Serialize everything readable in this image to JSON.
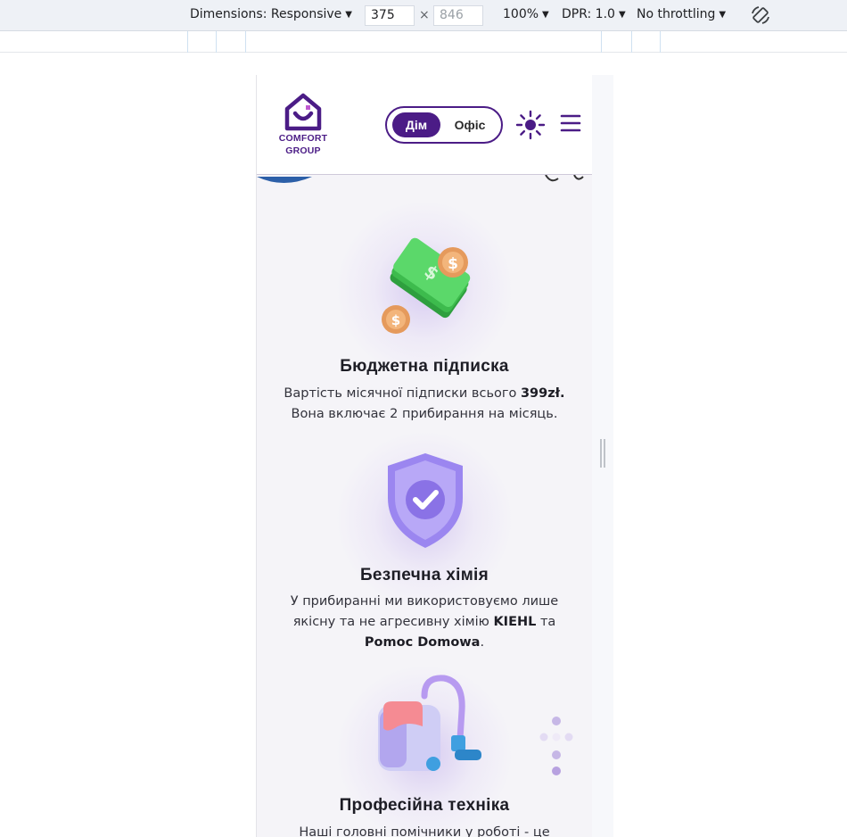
{
  "devtools": {
    "dimensions_label": "Dimensions: Responsive",
    "width_value": "375",
    "height_placeholder": "846",
    "times": "×",
    "zoom": "100%",
    "dpr": "DPR: 1.0",
    "throttling": "No throttling",
    "caret": "▼"
  },
  "header": {
    "logo_line1": "COMFORT",
    "logo_line2": "GROUP",
    "toggle_home": "Дім",
    "toggle_office": "Офіс"
  },
  "features": [
    {
      "title": "Бюджетна підписка",
      "text_before": "Вартість місячної підписки всього ",
      "bold1": "399zł.",
      "text_after": " Вона включає 2 прибирання на місяць."
    },
    {
      "title": "Безпечна хімія",
      "text_before": "У прибиранні ми використовуємо лише якісну та не агресивну хімію ",
      "bold1": "KIEHL",
      "text_mid": " та ",
      "bold2": "Pomoc Domowa",
      "text_after": "."
    },
    {
      "title": "Професійна техніка",
      "text_before": "Наші головні помічники у роботі - це"
    }
  ],
  "colors": {
    "brand_purple": "#4b1c86",
    "background": "#f5f4f8"
  }
}
